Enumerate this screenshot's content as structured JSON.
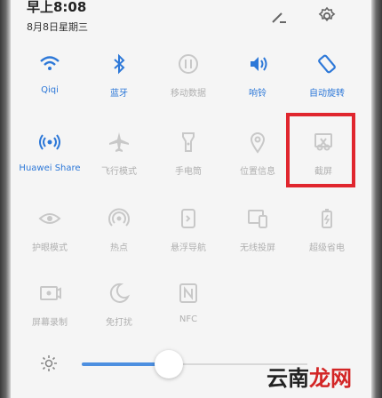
{
  "status": {
    "time": "早上8:08",
    "date": "8月8日星期三"
  },
  "header": {
    "edit_icon": "pencil-icon",
    "settings_icon": "gear-icon"
  },
  "toggles": [
    {
      "id": "wifi",
      "label": "Qiqi",
      "icon": "wifi-icon",
      "active": true
    },
    {
      "id": "bluetooth",
      "label": "蓝牙",
      "icon": "bluetooth-icon",
      "active": true
    },
    {
      "id": "mobile-data",
      "label": "移动数据",
      "icon": "mobile-data-icon",
      "active": false
    },
    {
      "id": "sound",
      "label": "响铃",
      "icon": "speaker-icon",
      "active": true
    },
    {
      "id": "auto-rotate",
      "label": "自动旋转",
      "icon": "rotate-icon",
      "active": true
    },
    {
      "id": "huawei-share",
      "label": "Huawei Share",
      "icon": "share-icon",
      "active": true
    },
    {
      "id": "airplane",
      "label": "飞行模式",
      "icon": "airplane-icon",
      "active": false
    },
    {
      "id": "flashlight",
      "label": "手电筒",
      "icon": "flashlight-icon",
      "active": false
    },
    {
      "id": "location",
      "label": "位置信息",
      "icon": "location-pin-icon",
      "active": false
    },
    {
      "id": "screenshot",
      "label": "截屏",
      "icon": "scissors-icon",
      "active": false
    },
    {
      "id": "eye-comfort",
      "label": "护眼模式",
      "icon": "eye-icon",
      "active": false
    },
    {
      "id": "hotspot",
      "label": "热点",
      "icon": "hotspot-icon",
      "active": false
    },
    {
      "id": "floating-dock",
      "label": "悬浮导航",
      "icon": "floating-dock-icon",
      "active": false
    },
    {
      "id": "wireless-projection",
      "label": "无线投屏",
      "icon": "projection-icon",
      "active": false
    },
    {
      "id": "power-saver",
      "label": "超级省电",
      "icon": "battery-icon",
      "active": false
    },
    {
      "id": "screen-record",
      "label": "屏幕录制",
      "icon": "screen-record-icon",
      "active": false
    },
    {
      "id": "do-not-disturb",
      "label": "免打扰",
      "icon": "moon-icon",
      "active": false
    },
    {
      "id": "nfc",
      "label": "NFC",
      "icon": "nfc-icon",
      "active": false
    }
  ],
  "brightness": {
    "icon": "sun-icon",
    "level": 0.3
  },
  "watermark": {
    "text_a": "云南",
    "text_b": "龙网"
  },
  "colors": {
    "active": "#2d78d8",
    "inactive": "#b0b0b0",
    "highlight": "#e0262e"
  }
}
